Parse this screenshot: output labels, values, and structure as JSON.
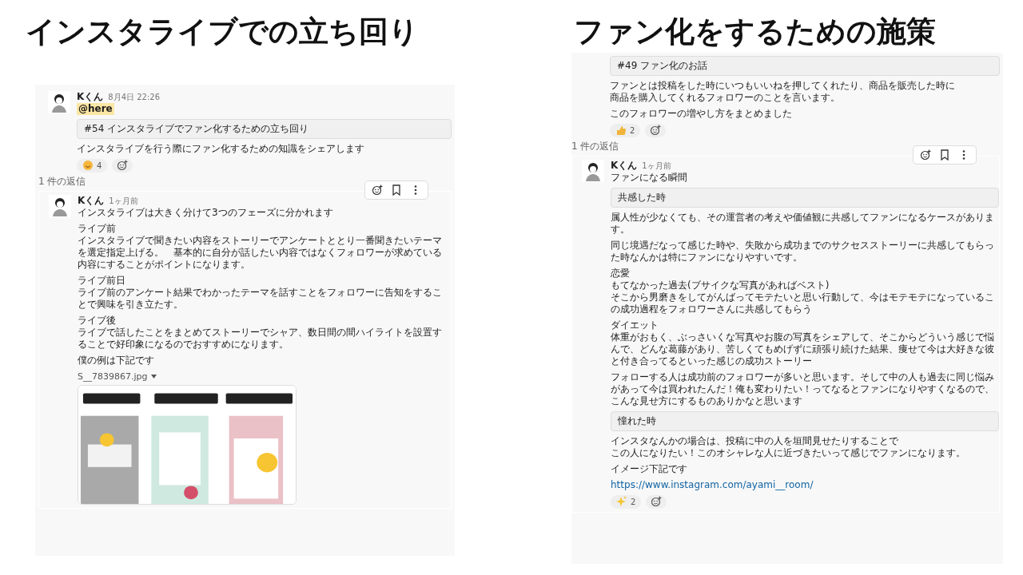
{
  "titles": [
    "インスタライブでの立ち回り",
    "ファン化をするための施策"
  ],
  "panels": [
    {
      "parent": [
        {
          "kind": "header",
          "name": "Kくん",
          "time": "8月4日 22:26"
        },
        {
          "kind": "mention",
          "text": "@here"
        },
        {
          "kind": "quote",
          "text": "#54  インスタライブでファン化するための立ち回り"
        },
        {
          "kind": "text",
          "lines": [
            "インスタライブを行う際にファン化するための知識をシェアします"
          ]
        },
        {
          "kind": "reactions",
          "items": [
            {
              "kind": "smile",
              "count": "4"
            }
          ]
        }
      ],
      "reply_label": "1 件の返信",
      "reply": [
        {
          "kind": "header",
          "name": "Kくん",
          "time": "1ヶ月前"
        },
        {
          "kind": "text",
          "lines": [
            "インスタライブは大きく分けて3つのフェーズに分かれます"
          ]
        },
        {
          "kind": "text",
          "lines": [
            "ライブ前",
            "インスタライブで聞きたい内容をストーリーでアンケートととり一番聞きたいテーマを選定指定上げる。　基本的に自分が話したい内容ではなくフォロワーが求めている内容にすることがポイントになります。"
          ]
        },
        {
          "kind": "text",
          "lines": [
            "ライブ前日",
            "ライブ前のアンケート結果でわかったテーマを話すことをフォロワーに告知をすることで興味を引き立たす。"
          ]
        },
        {
          "kind": "text",
          "lines": [
            "ライブ後",
            "ライブで話したことをまとめてストーリーでシャア、数日間の間ハイライトを設置することで好印象になるのでおすすめになります。"
          ]
        },
        {
          "kind": "text",
          "lines": [
            "僕の例は下記です"
          ]
        },
        {
          "kind": "file",
          "name": "S__7839867.jpg"
        },
        {
          "kind": "picture"
        }
      ]
    },
    {
      "parent": [
        {
          "kind": "quote",
          "text": "#49  ファン化のお話"
        },
        {
          "kind": "text",
          "lines": [
            "ファンとは投稿をした時にいつもいいねを押してくれたり、商品を販売した時に",
            "商品を購入してくれるフォロワーのことを言います。"
          ]
        },
        {
          "kind": "text",
          "lines": [
            "このフォロワーの増やし方をまとめました"
          ]
        },
        {
          "kind": "reactions",
          "items": [
            {
              "kind": "thumbs",
              "count": "2"
            }
          ]
        }
      ],
      "reply_label": "1 件の返信",
      "reply": [
        {
          "kind": "header",
          "name": "Kくん",
          "time": "1ヶ月前"
        },
        {
          "kind": "text",
          "lines": [
            "ファンになる瞬間"
          ]
        },
        {
          "kind": "quote",
          "text": "共感した時"
        },
        {
          "kind": "text",
          "lines": [
            "属人性が少なくても、その運営者の考えや価値観に共感してファンになるケースがあります。"
          ]
        },
        {
          "kind": "text",
          "lines": [
            "同じ境遇だなって感じた時や、失敗から成功までのサクセスストーリーに共感してもらった時なんかは特にファンになりやすいです。"
          ]
        },
        {
          "kind": "text",
          "lines": [
            "恋愛",
            "もてなかった過去(ブサイクな写真があればベスト)",
            "そこから男磨きをしてがんばってモテたいと思い行動して、今はモテモテになっているこの成功過程をフォロワーさんに共感してもらう"
          ]
        },
        {
          "kind": "text",
          "lines": [
            "ダイエット",
            "体重がおもく、ぶっさいくな写真やお腹の写真をシェアして、そこからどういう感じで悩んで、どんな葛藤があり、苦しくてもめげずに頑張り続けた結果、痩せて今は大好きな彼と付き合ってるといった感じの成功ストーリー"
          ]
        },
        {
          "kind": "text",
          "lines": [
            "フォローする人は成功前のフォロワーが多いと思います。そして中の人も過去に同じ悩みがあって今は買われたんだ！俺も変わりたい！ってなるとファンになりやすくなるので、こんな見せ方にするものありかなと思います"
          ]
        },
        {
          "kind": "quote",
          "text": "憧れた時"
        },
        {
          "kind": "text",
          "lines": [
            "インスタなんかの場合は、投稿に中の人を垣間見せたりすることで",
            "この人になりたい！このオシャレな人に近づきたいって感じでファンになります。"
          ]
        },
        {
          "kind": "text",
          "lines": [
            "イメージ下記です"
          ]
        },
        {
          "kind": "link",
          "text": "https://www.instagram.com/ayami__room/"
        },
        {
          "kind": "reactions",
          "items": [
            {
              "kind": "sparkle",
              "count": "2"
            }
          ]
        }
      ]
    }
  ]
}
